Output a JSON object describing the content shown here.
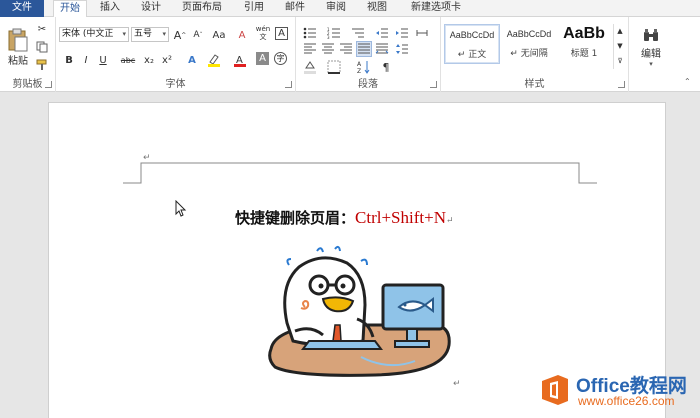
{
  "tabs": [
    "文件",
    "开始",
    "插入",
    "设计",
    "页面布局",
    "引用",
    "邮件",
    "审阅",
    "视图",
    "新建选项卡"
  ],
  "clipboard": {
    "paste_label": "粘贴",
    "group_label": "剪贴板"
  },
  "font": {
    "name": "宋体 (中文正",
    "size": "五号",
    "group_label": "字体",
    "bold": "B",
    "italic": "I",
    "underline": "U",
    "strike": "abc",
    "subscript": "x₂",
    "superscript": "x²",
    "case": "Aa",
    "phonetic": "wén",
    "char_border": "A"
  },
  "paragraph": {
    "group_label": "段落"
  },
  "styles": {
    "group_label": "样式",
    "items": [
      {
        "sample": "AaBbCcDd",
        "name": "↵ 正文"
      },
      {
        "sample": "AaBbCcDd",
        "name": "↵ 无间隔"
      },
      {
        "sample": "AaBb",
        "name": "标题 1"
      }
    ]
  },
  "editing": {
    "label": "编辑"
  },
  "document": {
    "title_text": "快捷键删除页眉：",
    "shortcut": "Ctrl+Shift+N",
    "para_mark": "↵"
  },
  "watermark": {
    "brand": "Office教程网",
    "url": "www.office26.com"
  },
  "colors": {
    "file_tab": "#2b579a",
    "shortcut_text": "#c00000",
    "logo_blue": "#2a66b2",
    "logo_orange": "#e86b1f"
  }
}
